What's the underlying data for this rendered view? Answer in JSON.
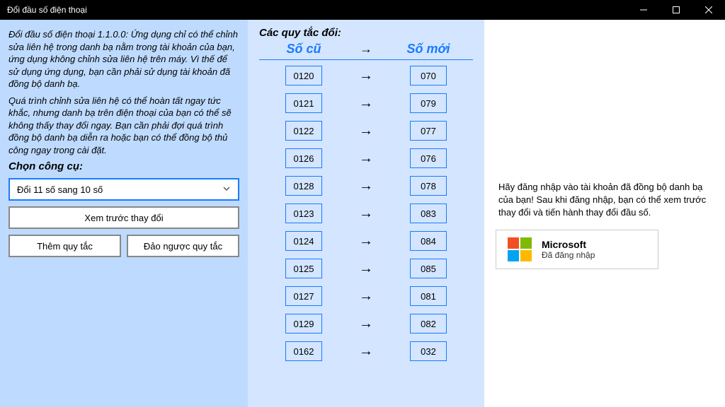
{
  "window": {
    "title": "Đổi đầu số điện thoại"
  },
  "left": {
    "para1": "Đổi đầu số điện thoại 1.1.0.0: Ứng dụng chỉ có thể chỉnh sửa liên hệ trong danh bạ nằm trong tài khoản của bạn, ứng dụng không chỉnh sửa liên hệ trên máy. Vì thế để sử dụng ứng dụng, bạn cần phải sử dụng tài khoản đã đồng bộ danh bạ.",
    "para2": "Quá trình chỉnh sửa liên hệ có thể hoàn tất ngay tức khắc, nhưng danh bạ trên điện thoại của bạn có thể sẽ không thấy thay đổi ngay. Bạn cần phải đợi quá trình đồng bộ danh bạ diễn ra hoặc bạn có thể đồng bộ thủ công ngay trong cài đặt.",
    "tool_heading": "Chọn công cụ:",
    "select_value": "Đổi 11 số sang 10 số",
    "preview_btn": "Xem trước thay đổi",
    "add_rule_btn": "Thêm quy tắc",
    "reverse_rule_btn": "Đảo ngược quy tắc"
  },
  "middle": {
    "heading": "Các quy tắc đổi:",
    "old_label": "Số cũ",
    "new_label": "Số mới",
    "rules": [
      {
        "old": "0120",
        "new": "070"
      },
      {
        "old": "0121",
        "new": "079"
      },
      {
        "old": "0122",
        "new": "077"
      },
      {
        "old": "0126",
        "new": "076"
      },
      {
        "old": "0128",
        "new": "078"
      },
      {
        "old": "0123",
        "new": "083"
      },
      {
        "old": "0124",
        "new": "084"
      },
      {
        "old": "0125",
        "new": "085"
      },
      {
        "old": "0127",
        "new": "081"
      },
      {
        "old": "0129",
        "new": "082"
      },
      {
        "old": "0162",
        "new": "032"
      }
    ]
  },
  "right": {
    "note": "Hãy đăng nhập vào tài khoản đã đồng bộ danh bạ của bạn! Sau khi đăng nhập, bạn có thể xem trước thay đổi và tiến hành thay đổi đầu số.",
    "ms_name": "Microsoft",
    "ms_status": "Đã đăng nhập"
  }
}
